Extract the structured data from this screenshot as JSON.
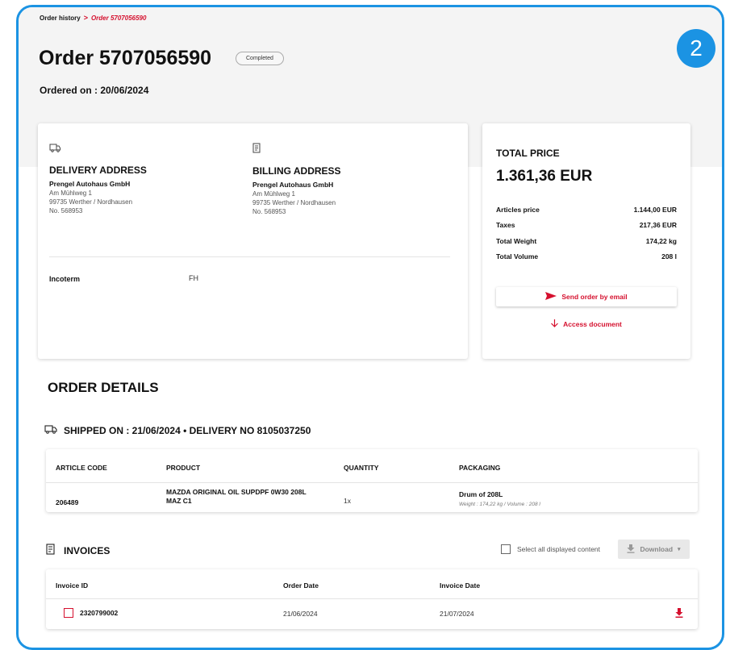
{
  "step_badge": "2",
  "breadcrumb": {
    "parent": "Order history",
    "separator": ">",
    "current": "Order 5707056590"
  },
  "header": {
    "title": "Order 5707056590",
    "status": "Completed",
    "ordered_on": "Ordered on : 20/06/2024"
  },
  "delivery": {
    "heading": "DELIVERY ADDRESS",
    "company": "Prengel Autohaus GmbH",
    "street": "Am Mühlweg 1",
    "city": "99735 Werther / Nordhausen",
    "number": "No. 568953"
  },
  "billing": {
    "heading": "BILLING ADDRESS",
    "company": "Prengel Autohaus GmbH",
    "street": "Am Mühlweg 1",
    "city": "99735 Werther / Nordhausen",
    "number": "No. 568953"
  },
  "incoterm": {
    "label": "Incoterm",
    "value": "FH"
  },
  "price": {
    "heading": "TOTAL PRICE",
    "total": "1.361,36 EUR",
    "rows": [
      {
        "label": "Articles price",
        "value": "1.144,00 EUR"
      },
      {
        "label": "Taxes",
        "value": "217,36 EUR"
      },
      {
        "label": "Total Weight",
        "value": "174,22 kg"
      },
      {
        "label": "Total Volume",
        "value": "208 l"
      }
    ],
    "send_email": "Send order by email",
    "access_document": "Access document"
  },
  "order_details": {
    "heading": "ORDER DETAILS",
    "shipped": "SHIPPED ON : 21/06/2024 • DELIVERY NO 8105037250",
    "columns": [
      "ARTICLE CODE",
      "PRODUCT",
      "QUANTITY",
      "PACKAGING"
    ],
    "row": {
      "article_code": "206489",
      "product_line1": "MAZDA ORIGINAL OIL SUPDPF 0W30 208L",
      "product_line2": "MAZ C1",
      "quantity": "1x",
      "packaging": "Drum of 208L",
      "packaging_detail": "Weight : 174,22 kg / Volume : 208 l"
    }
  },
  "invoices": {
    "heading": "INVOICES",
    "select_all": "Select all displayed content",
    "download": "Download",
    "columns": [
      "Invoice ID",
      "Order Date",
      "Invoice Date"
    ],
    "row": {
      "id": "2320799002",
      "order_date": "21/06/2024",
      "invoice_date": "21/07/2024"
    }
  },
  "colors": {
    "accent": "#d5102e",
    "frame": "#1b93e3"
  }
}
